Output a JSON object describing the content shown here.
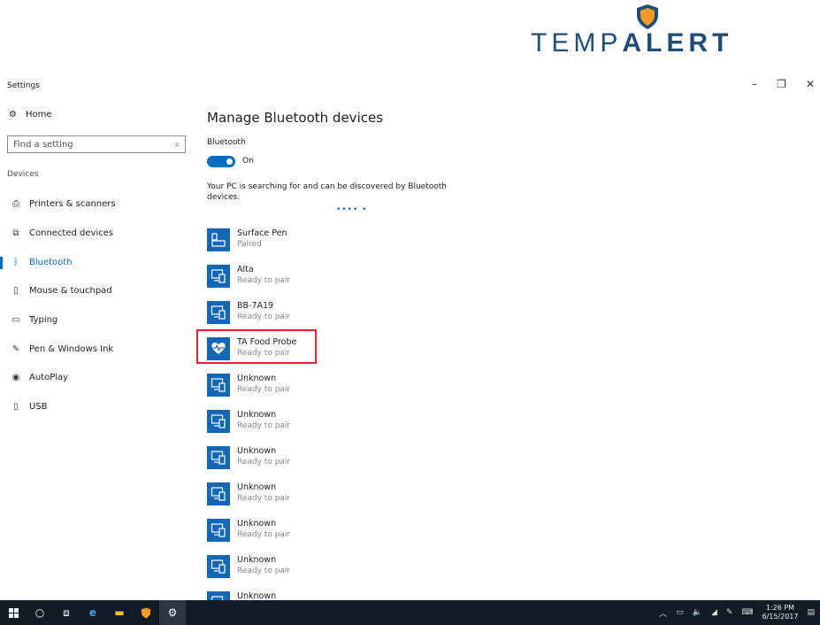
{
  "brand": {
    "word_light": "TEMP",
    "word_bold": "ALERT",
    "shield_color": "#f09a28",
    "text_color": "#1f4e79"
  },
  "window": {
    "title": "Settings",
    "minimize": "–",
    "restore": "❐",
    "close": "✕"
  },
  "sidebar": {
    "home": "Home",
    "search_placeholder": "Find a setting",
    "category": "Devices",
    "items": [
      {
        "label": "Printers & scanners",
        "icon": "printer-icon"
      },
      {
        "label": "Connected devices",
        "icon": "connected-devices-icon"
      },
      {
        "label": "Bluetooth",
        "icon": "bluetooth-icon",
        "active": true
      },
      {
        "label": "Mouse & touchpad",
        "icon": "mouse-icon"
      },
      {
        "label": "Typing",
        "icon": "keyboard-icon"
      },
      {
        "label": "Pen & Windows Ink",
        "icon": "pen-icon"
      },
      {
        "label": "AutoPlay",
        "icon": "autoplay-icon"
      },
      {
        "label": "USB",
        "icon": "usb-icon"
      }
    ]
  },
  "main": {
    "title": "Manage Bluetooth devices",
    "bluetooth_label": "Bluetooth",
    "toggle_state": "On",
    "info": "Your PC is searching for and can be discovered by Bluetooth devices.",
    "progress_dots": "•••• •",
    "devices": [
      {
        "name": "Surface Pen",
        "status": "Paired",
        "icon": "keyboard-device-icon"
      },
      {
        "name": "Alta",
        "status": "Ready to pair",
        "icon": "device-icon"
      },
      {
        "name": "BB-7A19",
        "status": "Ready to pair",
        "icon": "device-icon"
      },
      {
        "name": "TA Food Probe",
        "status": "Ready to pair",
        "icon": "heart-rate-icon",
        "highlighted": true
      },
      {
        "name": "Unknown",
        "status": "Ready to pair",
        "icon": "device-icon"
      },
      {
        "name": "Unknown",
        "status": "Ready to pair",
        "icon": "device-icon"
      },
      {
        "name": "Unknown",
        "status": "Ready to pair",
        "icon": "device-icon"
      },
      {
        "name": "Unknown",
        "status": "Ready to pair",
        "icon": "device-icon"
      },
      {
        "name": "Unknown",
        "status": "Ready to pair",
        "icon": "device-icon"
      },
      {
        "name": "Unknown",
        "status": "Ready to pair",
        "icon": "device-icon"
      },
      {
        "name": "Unknown",
        "status": "",
        "icon": "device-icon"
      }
    ]
  },
  "taskbar": {
    "time": "1:26 PM",
    "date": "6/15/2017",
    "accent": "#0b6bbf"
  }
}
